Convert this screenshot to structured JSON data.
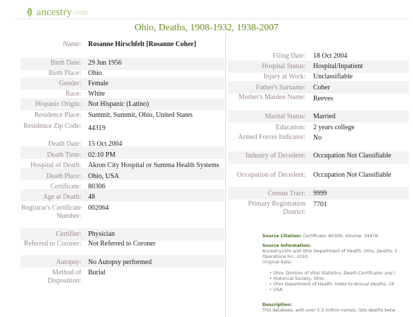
{
  "brand": {
    "name": "ancestry",
    "suffix": ".com"
  },
  "record_title": "Ohio, Deaths, 1908-1932, 1938-2007",
  "left_fields": [
    {
      "label": "Name:",
      "value": "Rosanne Hirschfelt [Rosanne Coher]"
    },
    {
      "label": "Birth Date:",
      "value": "29 Jun 1956"
    },
    {
      "label": "Birth Place:",
      "value": "Ohio"
    },
    {
      "label": "Gender:",
      "value": "Female"
    },
    {
      "label": "Race:",
      "value": "White"
    },
    {
      "label": "Hispanic Origin:",
      "value": "Not Hispanic (Latino)"
    },
    {
      "label": "Residence Place:",
      "value": "Summit, Summit, Ohio, United States"
    },
    {
      "label": "Residence Zip Code:",
      "value": "44319"
    },
    {
      "label": "Death Date:",
      "value": "15 Oct 2004"
    },
    {
      "label": "Death Time:",
      "value": "02:10 PM"
    },
    {
      "label": "Hospital of Death:",
      "value": "Akron City Hospital or Summa Health Systems"
    },
    {
      "label": "Death Place:",
      "value": "Ohio, USA"
    },
    {
      "label": "Certificate:",
      "value": "80306"
    },
    {
      "label": "Age at Death:",
      "value": "48"
    },
    {
      "label": "Registrar's Certificate Number:",
      "value": "002064"
    },
    {
      "label": "Certifier:",
      "value": "Physician"
    },
    {
      "label": "Referred to Coroner:",
      "value": "Not Referred to Coroner"
    },
    {
      "label": "Autopsy:",
      "value": "No Autopsy performed"
    },
    {
      "label": "Method of Disposition:",
      "value": "Burial"
    }
  ],
  "right_fields": [
    {
      "label": "Filing Date:",
      "value": "18 Oct 2004"
    },
    {
      "label": "Hospital Status:",
      "value": "Hospital/Inpatient"
    },
    {
      "label": "Injury at Work:",
      "value": "Unclassifiable"
    },
    {
      "label": "Father's Surname:",
      "value": "Coher"
    },
    {
      "label": "Mother's Maiden Name:",
      "value": "Reeves"
    },
    {
      "label": "Marital Status:",
      "value": "Married"
    },
    {
      "label": "Education:",
      "value": "2 years college"
    },
    {
      "label": "Armed Forces Indicator:",
      "value": "No"
    },
    {
      "label": "Industry of Decedent:",
      "value": "Occupation Not Classifiable"
    },
    {
      "label": "Occupation of Decedent:",
      "value": "Occupation Not Classifiable"
    },
    {
      "label": "Census Tract:",
      "value": "9999"
    },
    {
      "label": "Primary Registration District:",
      "value": "7701"
    }
  ],
  "source": {
    "citation_label": "Source Citation:",
    "citation_text": "Certificate: 80306; Volume: 34478.",
    "information_label": "Source Information:",
    "information_line1_plain": "Ancestry.com and Ohio Department of Health.",
    "information_line1_italic": "Ohio, Deaths, 1",
    "information_line2": "Operations Inc, 2010.",
    "original_data_label": "Original data:",
    "bullet1_plain": "Ohio. Division of Vital Statistics.",
    "bullet1_italic": "Death Certificates and i",
    "bullet1_line2": "Historical Society, Ohio.",
    "bullet2_plain": "Ohio Department of Health.",
    "bullet2_italic": "Index to Annual Deaths, 19",
    "bullet2_line2": "USA:",
    "description_label": "Description:",
    "description_text": "This database, with over 5.3 million names, lists deaths betw"
  },
  "colors": {
    "brand_green": "#8db04c",
    "title_green": "#6a8c1f",
    "label_mauve": "#9b8a87",
    "row_shade": "#f2f2f2"
  }
}
